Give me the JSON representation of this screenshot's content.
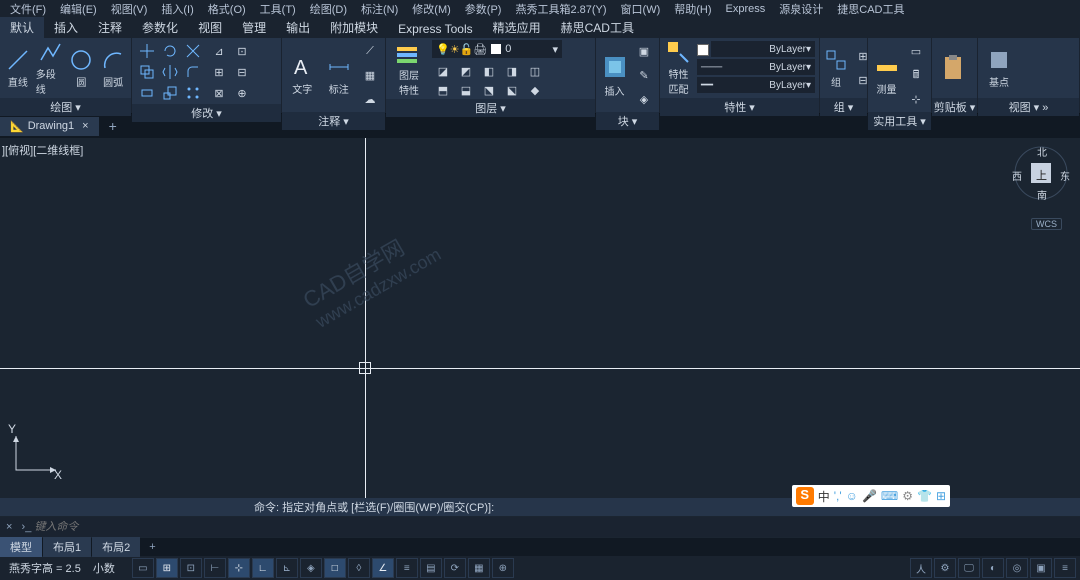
{
  "menubar": [
    "文件(F)",
    "编辑(E)",
    "视图(V)",
    "插入(I)",
    "格式(O)",
    "工具(T)",
    "绘图(D)",
    "标注(N)",
    "修改(M)",
    "参数(P)",
    "燕秀工具箱2.87(Y)",
    "窗口(W)",
    "帮助(H)",
    "Express",
    "源泉设计",
    "捷思CAD工具"
  ],
  "ribbon_tabs": [
    "默认",
    "插入",
    "注释",
    "参数化",
    "视图",
    "管理",
    "输出",
    "附加模块",
    "Express Tools",
    "精选应用",
    "赫思CAD工具"
  ],
  "ribbon_active": "默认",
  "panels": {
    "draw": {
      "title": "绘图 ▾",
      "buttons": [
        "直线",
        "多段线",
        "圆",
        "圆弧"
      ]
    },
    "modify": {
      "title": "修改 ▾"
    },
    "annot": {
      "title": "注释 ▾",
      "buttons": [
        "文字",
        "标注"
      ]
    },
    "layer": {
      "title": "图层 ▾",
      "label": "图层\n特性",
      "sel": "0"
    },
    "block": {
      "title": "块 ▾",
      "btn": "插入"
    },
    "prop": {
      "title": "特性 ▾",
      "btn": "特性\n匹配",
      "by": [
        "ByLayer",
        "ByLayer",
        "ByLayer"
      ]
    },
    "group": {
      "title": "组 ▾",
      "btn": "组"
    },
    "util": {
      "title": "实用工具 ▾",
      "btn": "测量"
    },
    "clip": {
      "title": "剪贴板 ▾"
    },
    "view": {
      "title": "视图 ▾ »",
      "btn": "基点"
    }
  },
  "doctab": "Drawing1",
  "viewport_label": "][俯视][二维线框]",
  "watermark": {
    "l1": "CAD自学网",
    "l2": "www.cadzxw.com"
  },
  "navcube": {
    "n": "北",
    "s": "南",
    "e": "东",
    "w": "西",
    "top": "上"
  },
  "wcs": "WCS",
  "ucs": {
    "x": "X",
    "y": "Y"
  },
  "cmd_hist": "命令: 指定对角点或 [栏选(F)/圈围(WP)/圈交(CP)]:",
  "cmd_placeholder": "键入命令",
  "ime": {
    "s": "S",
    "zh": "中",
    "icons": [
      "','",
      "☺",
      "🎤",
      "⌨",
      "⚙",
      "👕",
      "⊞"
    ]
  },
  "layout_tabs": [
    "模型",
    "布局1",
    "布局2"
  ],
  "layout_active": "模型",
  "status": {
    "text_h": "燕秀字高 = 2.5",
    "snap": "小数"
  }
}
